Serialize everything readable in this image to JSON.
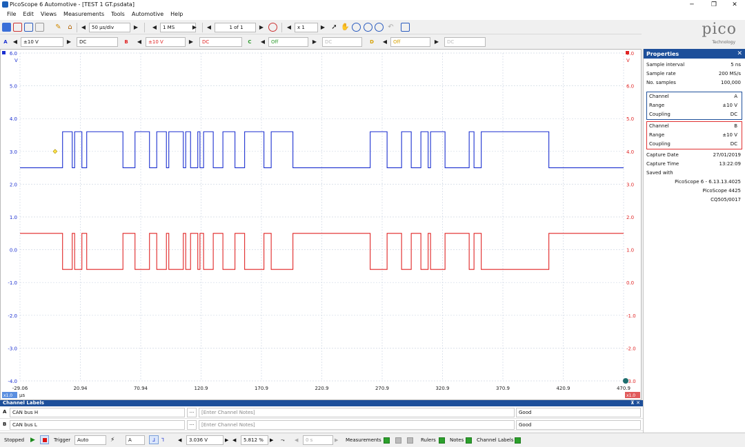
{
  "window": {
    "title": "PicoScope 6 Automotive - [TEST 1 GT.psdata]",
    "min": "─",
    "max": "❐",
    "close": "✕"
  },
  "menu": [
    "File",
    "Edit",
    "Views",
    "Measurements",
    "Tools",
    "Automotive",
    "Help"
  ],
  "logo": {
    "text": "pico",
    "sub": "Technology"
  },
  "toolbar1": {
    "timebase": "50 µs/div",
    "samples": "1 MS",
    "buffer": "1 of 1",
    "zoom": "x 1"
  },
  "toolbar2": {
    "a": {
      "letter": "A",
      "range": "±10 V",
      "coupling": "DC",
      "color": "#1a2fd0"
    },
    "b": {
      "letter": "B",
      "range": "±10 V",
      "coupling": "DC",
      "color": "#e02424"
    },
    "c": {
      "letter": "C",
      "range": "Off",
      "coupling": "DC",
      "color": "#2e9a2e"
    },
    "d": {
      "letter": "D",
      "range": "Off",
      "coupling": "DC",
      "color": "#d6a000"
    }
  },
  "axes": {
    "left_ticks": [
      "6.0",
      "5.0",
      "4.0",
      "3.0",
      "2.0",
      "1.0",
      "0.0",
      "-1.0",
      "-2.0",
      "-3.0",
      "-4.0"
    ],
    "left_unit": "V",
    "right_ticks": [
      "7.0",
      "6.0",
      "5.0",
      "4.0",
      "3.0",
      "2.0",
      "1.0",
      "0.0",
      "-1.0",
      "-2.0",
      "-3.0"
    ],
    "right_unit": "V",
    "x_ticks": [
      "-29.06",
      "20.94",
      "70.94",
      "120.9",
      "170.9",
      "220.9",
      "270.9",
      "320.9",
      "370.9",
      "420.9",
      "470.9"
    ],
    "x_unit": "µs",
    "x_zoom": "x1.0",
    "right_zoom": "x1.0"
  },
  "chart_data": {
    "type": "line",
    "x_range": [
      -29.06,
      470.9
    ],
    "series": [
      {
        "name": "CAN bus H",
        "color": "#1a2fd0",
        "axis": "A",
        "recessive": 2.5,
        "dominant": 3.6,
        "ylim": [
          -4,
          6
        ]
      },
      {
        "name": "CAN bus L",
        "color": "#e02424",
        "axis": "B",
        "recessive": 1.5,
        "dominant": 0.4,
        "ylim": [
          -3,
          7
        ]
      }
    ],
    "frame_bursts_us": [
      [
        0.2,
        120.0
      ],
      [
        123.0,
        210.0
      ],
      [
        243.0,
        429.0
      ]
    ],
    "grid": true
  },
  "properties": {
    "title": "Properties",
    "general": [
      {
        "k": "Sample interval",
        "v": "5 ns"
      },
      {
        "k": "Sample rate",
        "v": "200 MS/s"
      },
      {
        "k": "No. samples",
        "v": "100,000"
      }
    ],
    "chA": [
      {
        "k": "Channel",
        "v": "A"
      },
      {
        "k": "Range",
        "v": "±10 V"
      },
      {
        "k": "Coupling",
        "v": "DC"
      }
    ],
    "chB": [
      {
        "k": "Channel",
        "v": "B"
      },
      {
        "k": "Range",
        "v": "±10 V"
      },
      {
        "k": "Coupling",
        "v": "DC"
      }
    ],
    "capture": [
      {
        "k": "Capture Date",
        "v": "27/01/2019"
      },
      {
        "k": "Capture Time",
        "v": "13:22:09"
      }
    ],
    "saved_label": "Saved with",
    "saved": [
      "PicoScope 6 - 6.13.13.4025",
      "PicoScope 4425",
      "CQ505/0017"
    ]
  },
  "channel_labels": {
    "title": "Channel Labels",
    "rows": [
      {
        "ch": "A",
        "label": "CAN bus H",
        "notes_placeholder": "[Enter Channel Notes]",
        "status": "Good"
      },
      {
        "ch": "B",
        "label": "CAN bus L",
        "notes_placeholder": "[Enter Channel Notes]",
        "status": "Good"
      }
    ]
  },
  "status": {
    "state": "Stopped",
    "trigger_label": "Trigger",
    "trigger_mode": "Auto",
    "trigger_channel": "A",
    "threshold": "3.036 V",
    "pretrigger": "5.812 %",
    "delay": "0 s",
    "measurements": "Measurements",
    "rulers": "Rulers",
    "notes": "Notes",
    "channel_labels": "Channel Labels"
  }
}
